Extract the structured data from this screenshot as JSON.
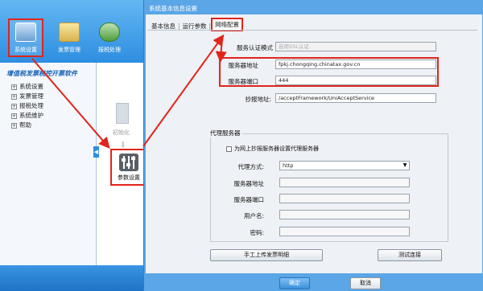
{
  "app": {
    "toolbar": [
      {
        "label": "系统设置",
        "icon": "system-settings-icon"
      },
      {
        "label": "发票管理",
        "icon": "invoice-folder-icon"
      },
      {
        "label": "报税处理",
        "icon": "tax-report-icon"
      }
    ],
    "tree_title": "增值税发票税控开票软件",
    "tree_items": [
      "系统设置",
      "发票管理",
      "报税处理",
      "系统维护",
      "帮助"
    ],
    "func": {
      "init_label": "初始化",
      "param_label": "参数设置"
    }
  },
  "dialog": {
    "title": "系统基本信息设置",
    "tabs": [
      "基本信息",
      "运行参数",
      "网络配置"
    ],
    "auth_mode": {
      "label": "服务认证模式",
      "value": "启用SSL认证"
    },
    "server_addr": {
      "label": "服务器地址",
      "value": "fpkj.chongqing.chinatax.gov.cn"
    },
    "server_port": {
      "label": "服务器端口",
      "value": "444"
    },
    "upload_addr": {
      "label": "抄报地址:",
      "value": "/acceptFramework/UniAcceptService"
    },
    "proxy": {
      "group_title": "代理服务器",
      "checkbox_label": "为网上抄报服务器设置代理服务器",
      "mode_label": "代理方式:",
      "mode_value": "http",
      "addr_label": "服务器地址",
      "port_label": "服务器端口",
      "user_label": "用户名:",
      "pwd_label": "密码:"
    },
    "buttons": {
      "upload_detail": "手工上传发票明细",
      "test": "测试连接",
      "ok": "确定",
      "cancel": "取消"
    }
  },
  "colors": {
    "highlight": "#e0251b",
    "title_blue": "#1b63b5",
    "frame_blue": "#5aa6e6"
  }
}
